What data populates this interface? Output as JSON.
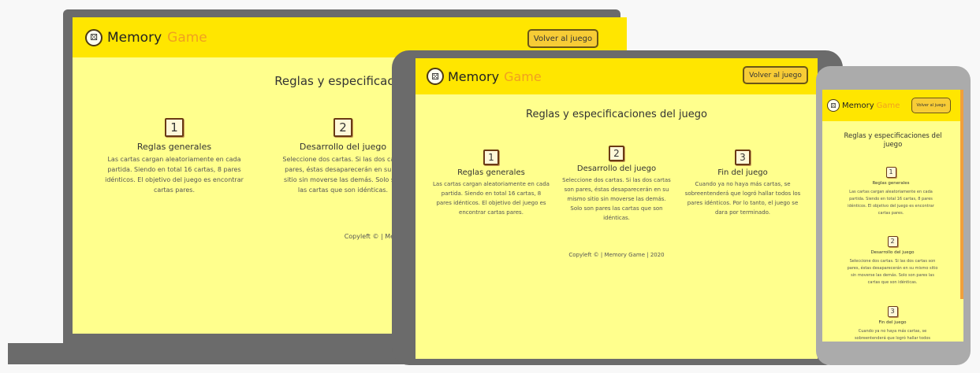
{
  "app": {
    "logo_word_1": "Memory",
    "logo_word_2": "Game",
    "back_button_label": "Volver al juego",
    "page_title": "Reglas y especificaciones del juego",
    "footer": "Copyleft © | Memory Game | 2020"
  },
  "laptop": {
    "page_title_visible": "Reglas y especificaciones d",
    "footer_visible": "Copyleft © | Memory Game | 2020"
  },
  "sections": [
    {
      "number": "1",
      "title": "Reglas generales",
      "text": "Las cartas cargan aleatoriamente en cada partida. Siendo en total 16 cartas, 8 pares idénticos. El objetivo del juego es encontrar cartas pares."
    },
    {
      "number": "2",
      "title": "Desarrollo del juego",
      "text": "Seleccione dos cartas. Si las dos cartas son pares, éstas desaparecerán en su mismo sitio sin moverse las demás. Solo son pares las cartas que son idénticas."
    },
    {
      "number": "3",
      "title": "Fin del juego",
      "text": "Cuando ya no haya más cartas, se sobreentenderá que logró hallar todos los pares idénticos. Por lo tanto, el juego se dara por terminado."
    }
  ],
  "laptop_section2_lines": [
    "Seleccione dos cartas. Si las dos carta",
    "pares, éstas desaparecerán en su mi",
    "sitio sin moverse las demás. Solo son",
    "las cartas que son idénticas."
  ],
  "phone_section3_lines": [
    "Cuando ya no haya más cartas, se",
    "sobreentenderá que logró hallar todos"
  ],
  "colors": {
    "header": "#ffe600",
    "page_bg": "#ffff8d",
    "button_bg": "#f7cc36",
    "logo_accent": "#f0a020",
    "device_frame": "#6b6b6b"
  }
}
